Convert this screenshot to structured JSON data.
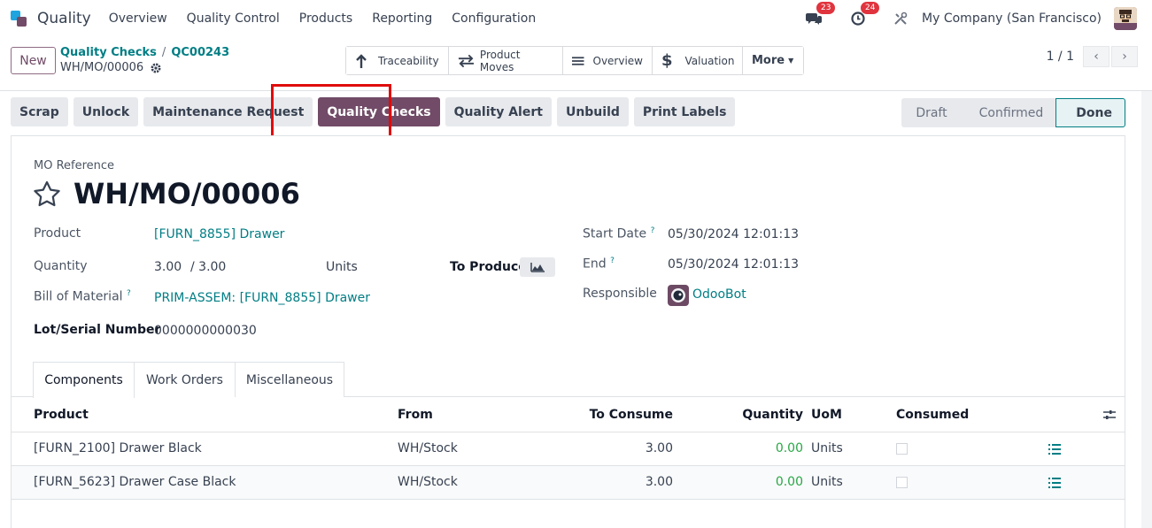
{
  "app": {
    "name": "Quality",
    "menu": [
      "Overview",
      "Quality Control",
      "Products",
      "Reporting",
      "Configuration"
    ],
    "messages_count": "23",
    "activities_count": "24",
    "company": "My Company (San Francisco)"
  },
  "control": {
    "new_label": "New",
    "breadcrumb_root": "Quality Checks",
    "breadcrumb_check": "QC00243",
    "record_name": "WH/MO/00006",
    "smart_buttons": {
      "traceability": "Traceability",
      "product_moves": "Product Moves",
      "overview": "Overview",
      "valuation": "Valuation",
      "more": "More"
    },
    "pager": "1 / 1"
  },
  "actions": {
    "scrap": "Scrap",
    "unlock": "Unlock",
    "maintenance": "Maintenance Request",
    "quality_checks": "Quality Checks",
    "quality_alert": "Quality Alert",
    "unbuild": "Unbuild",
    "print_labels": "Print Labels"
  },
  "status": {
    "draft": "Draft",
    "confirmed": "Confirmed",
    "done": "Done"
  },
  "form": {
    "ref_label": "MO Reference",
    "title": "WH/MO/00006",
    "product_label": "Product",
    "product_value": "[FURN_8855] Drawer",
    "quantity_label": "Quantity",
    "quantity_value": "3.00",
    "quantity_total": "/ 3.00",
    "quantity_uom": "Units",
    "to_produce_label": "To Produce",
    "bom_label": "Bill of Material",
    "bom_value": "PRIM-ASSEM: [FURN_8855] Drawer",
    "lot_label": "Lot/Serial Number",
    "lot_value": "0000000000030",
    "start_label": "Start Date",
    "start_value": "05/30/2024 12:01:13",
    "end_label": "End",
    "end_value": "05/30/2024 12:01:13",
    "responsible_label": "Responsible",
    "responsible_value": "OdooBot",
    "help_mark": "?"
  },
  "tabs": [
    "Components",
    "Work Orders",
    "Miscellaneous"
  ],
  "table": {
    "headers": {
      "product": "Product",
      "from": "From",
      "to_consume": "To Consume",
      "quantity": "Quantity",
      "uom": "UoM",
      "consumed": "Consumed"
    },
    "rows": [
      {
        "product": "[FURN_2100] Drawer Black",
        "from": "WH/Stock",
        "to_consume": "3.00",
        "quantity": "0.00",
        "uom": "Units"
      },
      {
        "product": "[FURN_5623] Drawer Case Black",
        "from": "WH/Stock",
        "to_consume": "3.00",
        "quantity": "0.00",
        "uom": "Units"
      }
    ]
  },
  "colors": {
    "brand": "#714b67",
    "link": "#017e84",
    "highlight": "#e00c0c",
    "success": "#28a745"
  }
}
